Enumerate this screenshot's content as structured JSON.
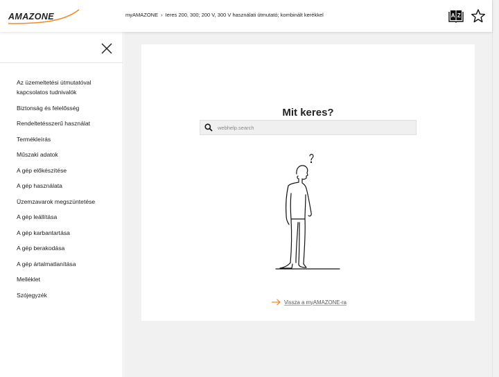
{
  "header": {
    "logo_text": "AMAZONE",
    "breadcrumb": {
      "home": "myAMAZONE",
      "separator": "›",
      "current": "Ieres 200, 300; 200 V, 300 V használati útmutató; kombinált kerékkel"
    },
    "glossary_icon": "glossary-az-book-icon",
    "favorite_icon": "star-outline-icon"
  },
  "sidebar": {
    "close_icon": "close-x-icon",
    "items": [
      {
        "label": "Az üzemeltetési útmutatóval kapcsolatos tudnivalók"
      },
      {
        "label": "Biztonság és felelősség"
      },
      {
        "label": "Rendeltetésszerű használat"
      },
      {
        "label": "Termékleírás"
      },
      {
        "label": "Műszaki adatok"
      },
      {
        "label": "A gép előkészítése"
      },
      {
        "label": "A gép használata"
      },
      {
        "label": "Üzemzavarok megszüntetése"
      },
      {
        "label": "A gép leállítása"
      },
      {
        "label": "A gép karbantartása"
      },
      {
        "label": "A gép berakodása"
      },
      {
        "label": "A gép ártalmatlanítása"
      },
      {
        "label": "Melléklet"
      },
      {
        "label": "Szójegyzék"
      }
    ]
  },
  "main": {
    "title": "Mit keres?",
    "search": {
      "placeholder": "webhelp.search",
      "value": ""
    },
    "illustration": "confused-man-question-mark",
    "back_link": "Vissza a myAMAZONE-ra"
  },
  "colors": {
    "accent_orange": "#f08a24",
    "background_gray": "#f1f1f1",
    "text_dark": "#1a1a1a"
  }
}
